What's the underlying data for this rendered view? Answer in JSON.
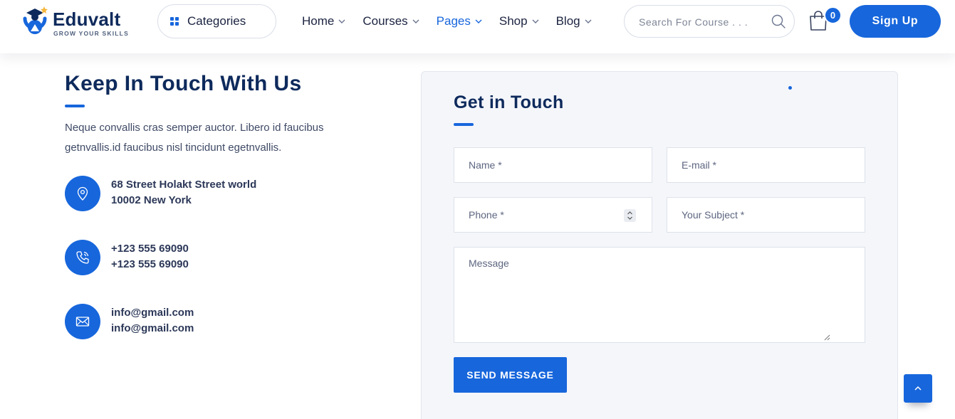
{
  "colors": {
    "accent": "#1766dc",
    "heading": "#0e2a5c",
    "card_bg": "#f4f6fa"
  },
  "header": {
    "logo": {
      "name": "Eduvalt",
      "tagline": "GROW YOUR SKILLS",
      "icon": "logo-mark-icon"
    },
    "categories_label": "Categories",
    "nav": [
      {
        "label": "Home",
        "active": false
      },
      {
        "label": "Courses",
        "active": false
      },
      {
        "label": "Pages",
        "active": true
      },
      {
        "label": "Shop",
        "active": false
      },
      {
        "label": "Blog",
        "active": false
      }
    ],
    "search_placeholder": "Search For Course . . .",
    "cart_count": "0",
    "signup_label": "Sign Up"
  },
  "contact": {
    "title": "Keep In Touch With Us",
    "description": "Neque convallis cras semper auctor. Libero id faucibus getnvallis.id faucibus nisl tincidunt egetnvallis.",
    "items": [
      {
        "icon": "map-pin-icon",
        "line1": "68 Street Holakt Street world",
        "line2": "10002 New York"
      },
      {
        "icon": "phone-icon",
        "line1": "+123 555 69090",
        "line2": "+123 555 69090"
      },
      {
        "icon": "mail-icon",
        "line1": "info@gmail.com",
        "line2": "info@gmail.com"
      }
    ]
  },
  "form": {
    "title": "Get in Touch",
    "name_placeholder": "Name *",
    "email_placeholder": "E-mail *",
    "phone_placeholder": "Phone *",
    "subject_placeholder": "Your Subject *",
    "message_placeholder": "Message",
    "submit_label": "SEND MESSAGE"
  }
}
